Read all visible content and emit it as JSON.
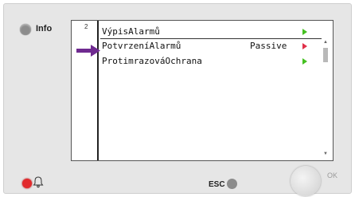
{
  "info": {
    "label": "Info"
  },
  "screen": {
    "level": "2",
    "header": "VýpisAlarmů",
    "rows": [
      {
        "name": "PotvrzeníAlarmů",
        "value": "Passive"
      },
      {
        "name": "ProtimrazováOchrana",
        "value": ""
      }
    ]
  },
  "controls": {
    "esc_label": "ESC",
    "ok_label": "OK"
  },
  "colors": {
    "accent_arrow": "#6f2a90",
    "alarm_led": "#e2292c",
    "go_green": "#44c020",
    "go_red": "#e0304a"
  },
  "icons": [
    "info-led-icon",
    "selection-arrow-icon",
    "bell-icon",
    "scroll-up-icon",
    "scroll-down-icon"
  ]
}
